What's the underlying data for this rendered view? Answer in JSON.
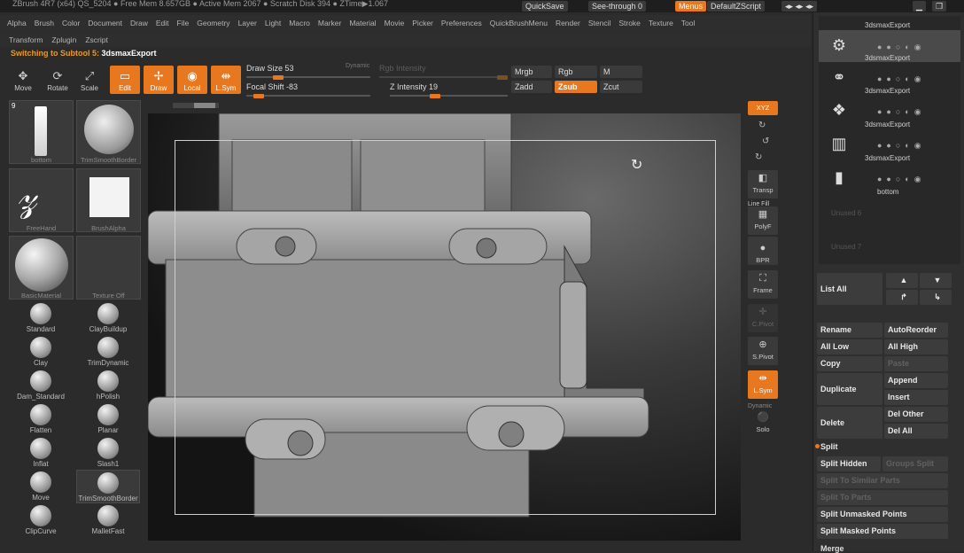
{
  "titlebar": {
    "text": "ZBrush 4R7 (x64)   QS_5204  ●  Free Mem 8.657GB ● Active Mem 2067 ● Scratch Disk 394 ●  ZTime▶1.067",
    "quicksave": "QuickSave",
    "seethrough": "See-through  0",
    "menus": "Menus",
    "zscript": "DefaultZScript"
  },
  "menubar": [
    "Alpha",
    "Brush",
    "Color",
    "Document",
    "Draw",
    "Edit",
    "File",
    "Geometry",
    "Layer",
    "Light",
    "Macro",
    "Marker",
    "Material",
    "Movie",
    "Picker",
    "Preferences",
    "QuickBrushMenu",
    "Render",
    "Stencil",
    "Stroke",
    "Texture",
    "Tool"
  ],
  "menubar2": [
    "Transform",
    "Zplugin",
    "Zscript"
  ],
  "status": {
    "prefix": "Switching to Subtool 5:",
    "name": "3dsmaxExport"
  },
  "toolbar": {
    "move": "Move",
    "rotate": "Rotate",
    "scale": "Scale",
    "edit": "Edit",
    "draw": "Draw",
    "local": "Local",
    "lsym": "L.Sym",
    "draw_size": "Draw Size 53",
    "dynamic": "Dynamic",
    "focal_shift": "Focal Shift -83",
    "rgb_intensity": "Rgb Intensity",
    "z_intensity": "Z Intensity 19",
    "mrgb": "Mrgb",
    "rgb": "Rgb",
    "m": "M",
    "zadd": "Zadd",
    "zsub": "Zsub",
    "zcut": "Zcut",
    "draw_size_value": 53,
    "focal_shift_value": -83,
    "z_intensity_value": 19
  },
  "left": {
    "thumbs": [
      {
        "label": "bottom",
        "count": "9"
      },
      {
        "label": "TrimSmoothBorder"
      },
      {
        "label": "FreeHand"
      },
      {
        "label": "BrushAlpha"
      },
      {
        "label": "BasicMaterial"
      },
      {
        "label": "Texture  Off"
      }
    ],
    "brushes": [
      "Standard",
      "ClayBuildup",
      "Clay",
      "TrimDynamic",
      "Dam_Standard",
      "hPolish",
      "Flatten",
      "Planar",
      "Inflat",
      "Slash1",
      "Move",
      "TrimSmoothBorder",
      "ClipCurve",
      "MalletFast"
    ]
  },
  "rightstrip": {
    "xyz": "XYZ",
    "transp": "Transp",
    "linefill": "Line Fill",
    "polyf": "PolyF",
    "bpr": "BPR",
    "frame": "Frame",
    "cpivot": "C.Pivot",
    "spivot": "S.Pivot",
    "lsym": "L.Sym",
    "dynamic": "Dynamic",
    "solo": "Solo"
  },
  "subtools": {
    "items": [
      {
        "name": "3dsmaxExport"
      },
      {
        "name": "3dsmaxExport"
      },
      {
        "name": "3dsmaxExport"
      },
      {
        "name": "3dsmaxExport"
      },
      {
        "name": "3dsmaxExport"
      }
    ],
    "bottom_label": "bottom",
    "unused6": "Unused 6",
    "unused7": "Unused 7"
  },
  "panel": {
    "list_all": "List All",
    "rename": "Rename",
    "autoreorder": "AutoReorder",
    "all_low": "All Low",
    "all_high": "All High",
    "copy": "Copy",
    "paste": "Paste",
    "duplicate": "Duplicate",
    "append": "Append",
    "insert": "Insert",
    "delete": "Delete",
    "del_other": "Del Other",
    "del_all": "Del All",
    "split": "Split",
    "split_hidden": "Split Hidden",
    "groups_split": "Groups Split",
    "split_similar": "Split To Similar Parts",
    "split_parts": "Split To Parts",
    "split_unmasked": "Split Unmasked Points",
    "split_masked": "Split Masked Points",
    "merge": "Merge"
  },
  "colors": {
    "accent": "#e8781f",
    "panel": "#2f2f2f",
    "bg": "#2b2b2b"
  }
}
